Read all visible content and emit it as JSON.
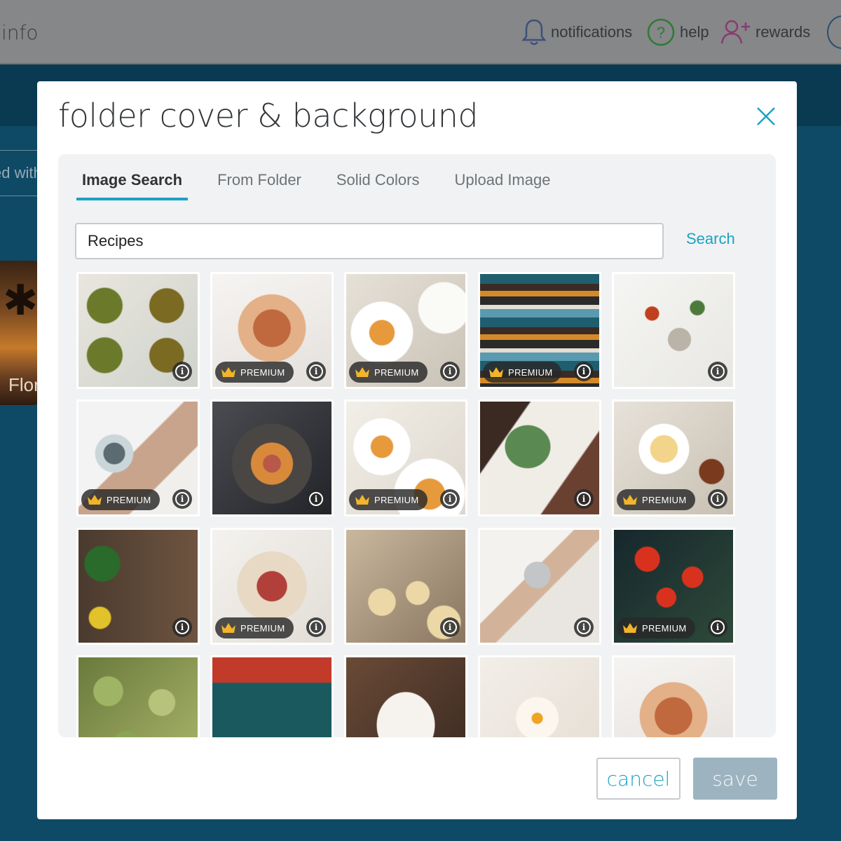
{
  "header": {
    "info_text": "info",
    "notifications_label": "notifications",
    "help_label": "help",
    "rewards_label": "rewards"
  },
  "background": {
    "side_tab_text": "ed with",
    "card_label": "Flor"
  },
  "modal": {
    "title": "folder cover & background",
    "tabs": [
      {
        "label": "Image Search"
      },
      {
        "label": "From Folder"
      },
      {
        "label": "Solid Colors"
      },
      {
        "label": "Upload Image"
      }
    ],
    "search": {
      "value": "Recipes",
      "button_label": "Search"
    },
    "premium_label": "PREMIUM",
    "info_glyph": "i",
    "images": [
      {
        "subject": "meal prep containers",
        "premium": false
      },
      {
        "subject": "salad bowl",
        "premium": true
      },
      {
        "subject": "soup with flowers",
        "premium": true
      },
      {
        "subject": "stack of cookbooks",
        "premium": true
      },
      {
        "subject": "spices and herbs",
        "premium": false
      },
      {
        "subject": "reading a cookbook",
        "premium": true
      },
      {
        "subject": "mortar with vegetables",
        "premium": false
      },
      {
        "subject": "soup bowls with flowers",
        "premium": true
      },
      {
        "subject": "open recipe book",
        "premium": false
      },
      {
        "subject": "table spread",
        "premium": true
      },
      {
        "subject": "vegetables on wood",
        "premium": false
      },
      {
        "subject": "chia pudding bowl",
        "premium": true
      },
      {
        "subject": "dough balls",
        "premium": false
      },
      {
        "subject": "baking in kitchen",
        "premium": false
      },
      {
        "subject": "tomato appetizers",
        "premium": true
      },
      {
        "subject": "green tomatillos",
        "premium": false
      },
      {
        "subject": "neon sign",
        "premium": false
      },
      {
        "subject": "magazine",
        "premium": false
      },
      {
        "subject": "eggs and flour",
        "premium": false
      },
      {
        "subject": "salad plate",
        "premium": false
      }
    ],
    "cancel_label": "cancel",
    "save_label": "save"
  },
  "colors": {
    "accent": "#1aa3c5",
    "backdrop": "#0d4862",
    "save_disabled": "#9db4c0"
  }
}
